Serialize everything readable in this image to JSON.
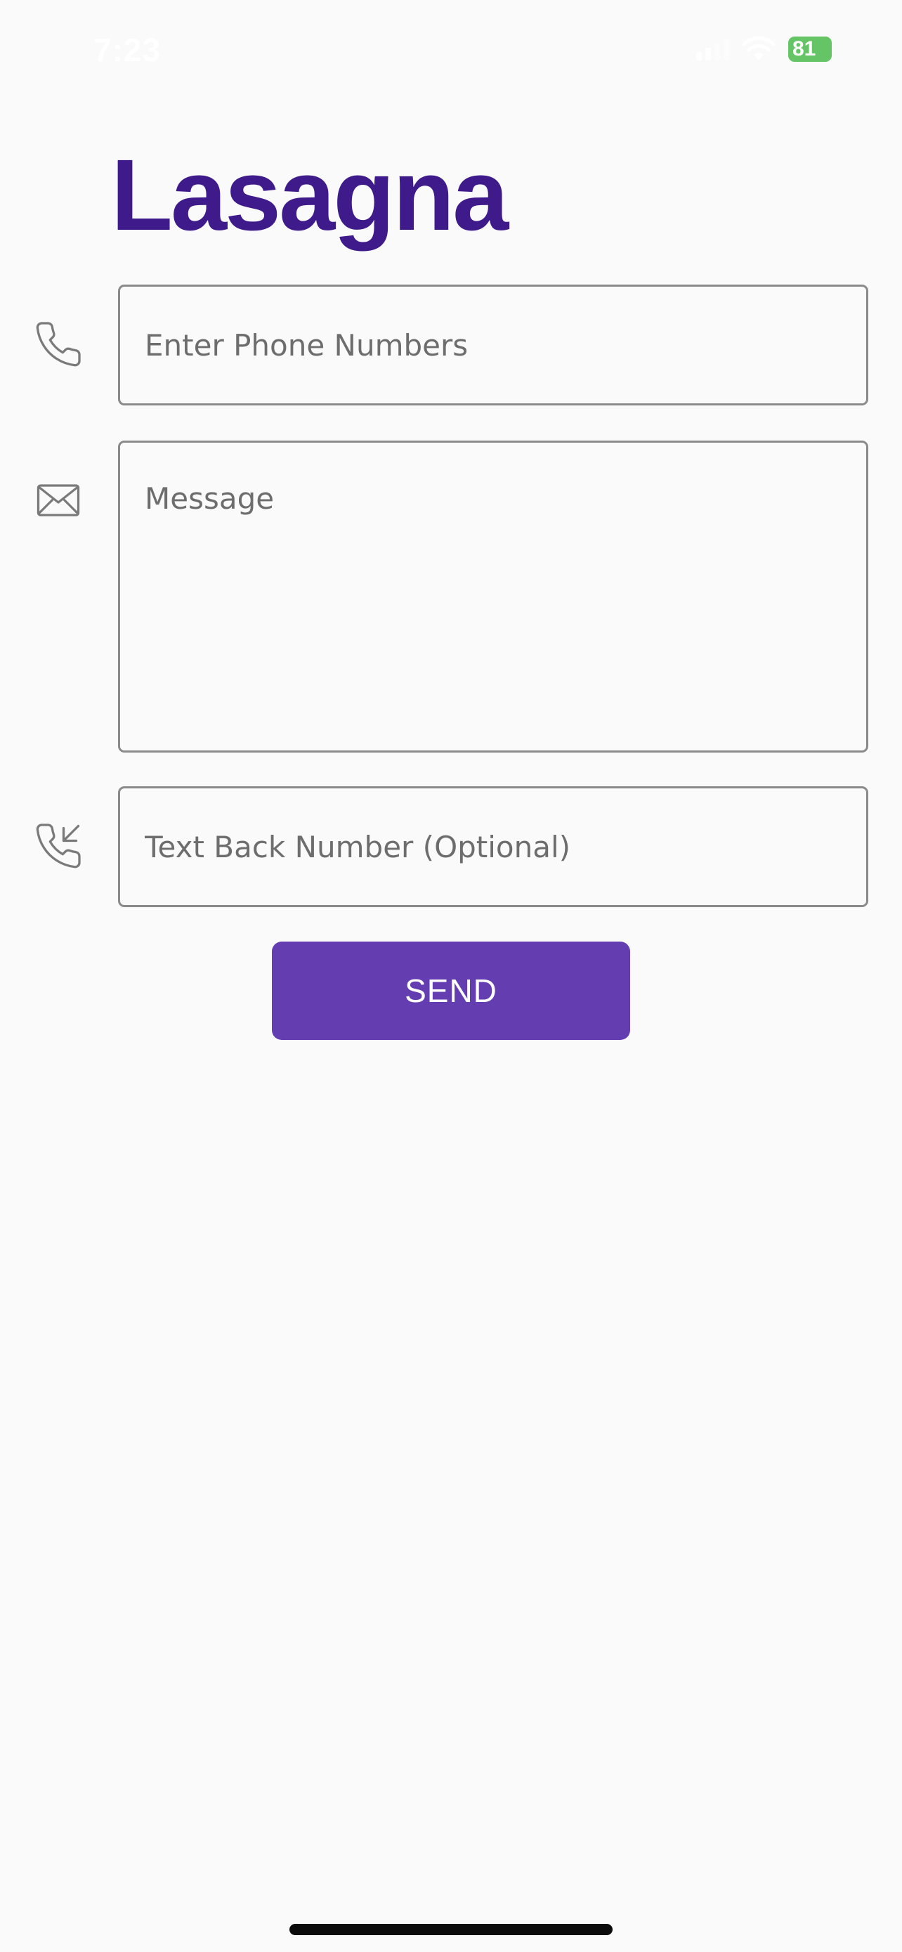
{
  "status_bar": {
    "time": "7:23",
    "battery_level": "81"
  },
  "app": {
    "title": "Lasagna"
  },
  "form": {
    "phone_numbers": {
      "placeholder": "Enter Phone Numbers",
      "value": "",
      "icon": "phone-icon"
    },
    "message": {
      "placeholder": "Message",
      "value": "",
      "icon": "envelope-icon"
    },
    "text_back_number": {
      "placeholder": "Text Back Number (Optional)",
      "value": "",
      "icon": "incoming-call-icon"
    },
    "send_label": "SEND"
  },
  "colors": {
    "brand_title": "#3f1a8a",
    "button_background": "#643eb0",
    "background": "#fafafa",
    "field_border": "#8a8a8a",
    "battery": "#65c466"
  }
}
